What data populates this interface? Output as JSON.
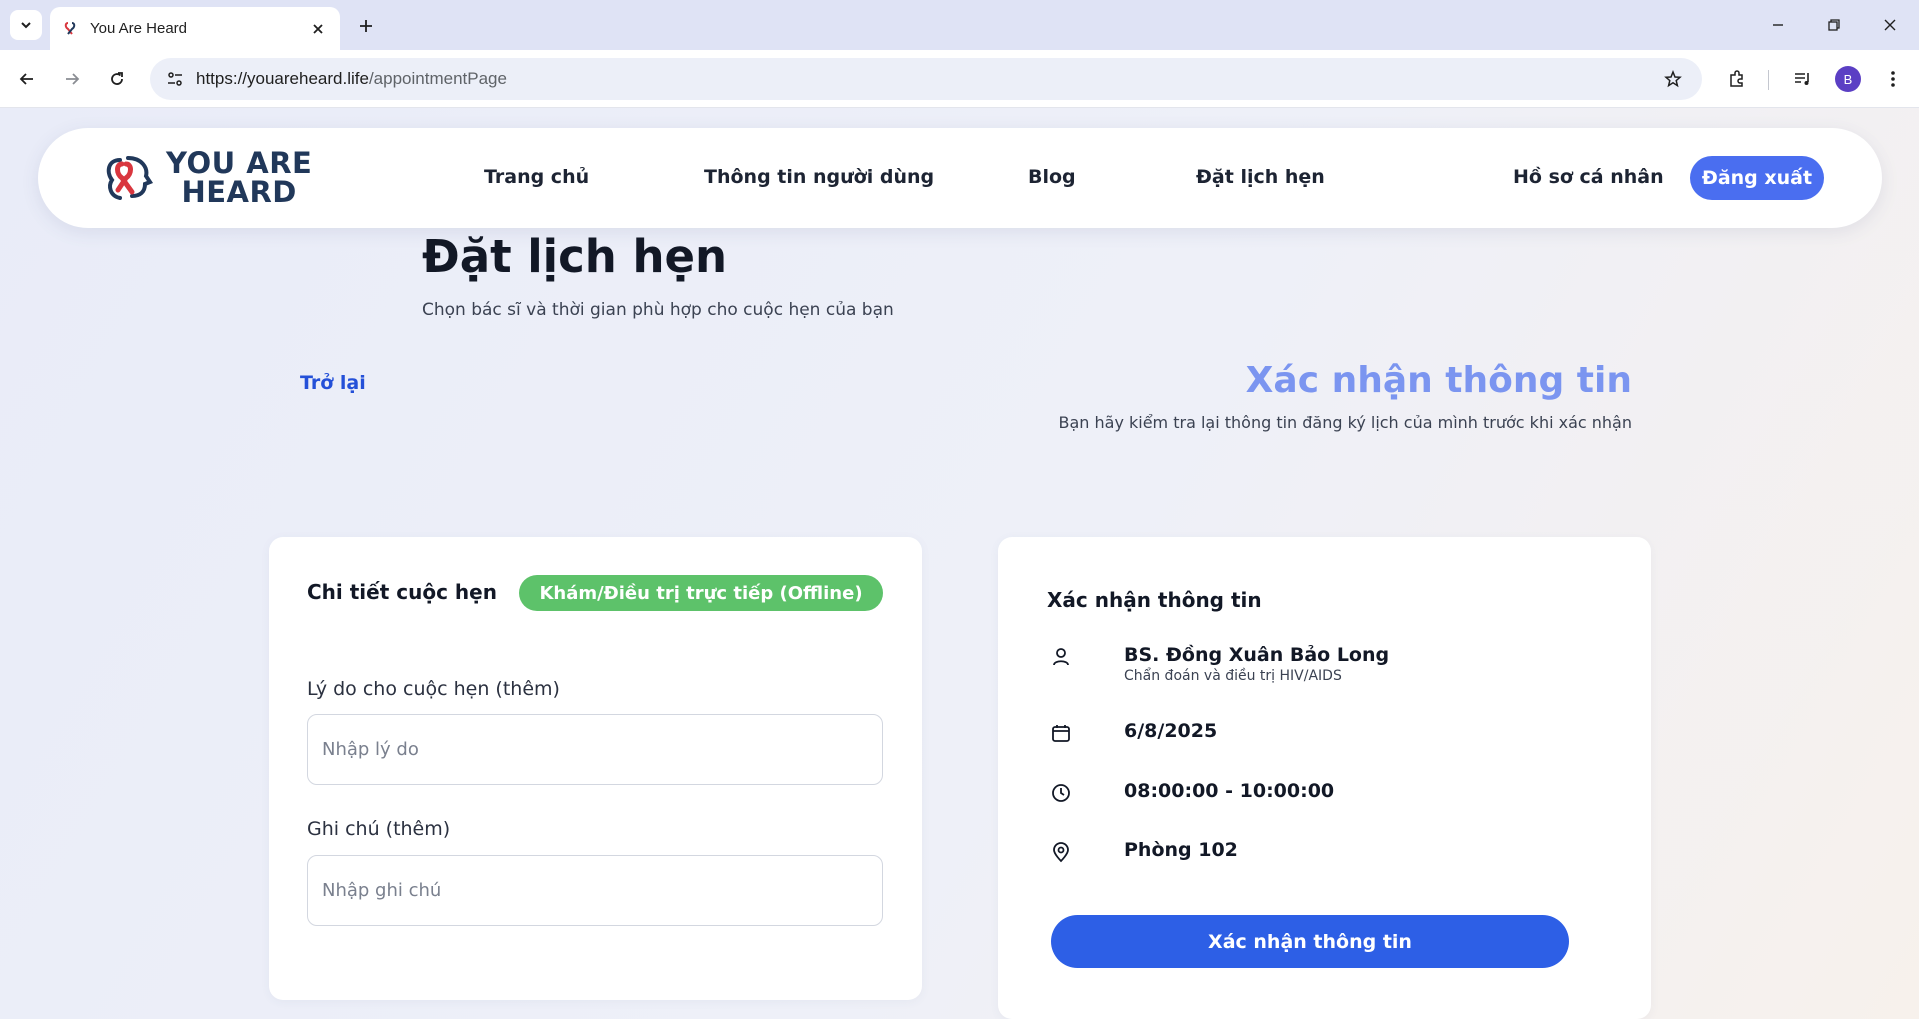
{
  "browser": {
    "tab_title": "You Are Heard",
    "url_host": "https://youareheard.life",
    "url_path": "/appointmentPage",
    "profile_initial": "B"
  },
  "header": {
    "logo_line1": "YOU ARE",
    "logo_line2": "HEARD",
    "nav": {
      "home": "Trang chủ",
      "user_info": "Thông tin người dùng",
      "blog": "Blog",
      "booking": "Đặt lịch hẹn"
    },
    "profile": "Hồ sơ cá nhân",
    "logout": "Đăng xuất"
  },
  "page": {
    "title": "Đặt lịch hẹn",
    "subtitle": "Chọn bác sĩ và thời gian phù hợp cho cuộc hẹn của bạn",
    "back": "Trở lại",
    "confirm_heading": "Xác nhận thông tin",
    "confirm_desc": "Bạn hãy kiểm tra lại thông tin đăng ký lịch của mình trước khi xác nhận"
  },
  "details": {
    "title": "Chi tiết cuộc hẹn",
    "badge": "Khám/Điều trị trực tiếp (Offline)",
    "reason_label": "Lý do cho cuộc hẹn (thêm)",
    "reason_placeholder": "Nhập lý do",
    "note_label": "Ghi chú (thêm)",
    "note_placeholder": "Nhập ghi chú"
  },
  "confirm": {
    "title": "Xác nhận thông tin",
    "doctor_name": "BS. Đồng Xuân Bảo Long",
    "doctor_specialty": "Chẩn đoán và điều trị HIV/AIDS",
    "date": "6/8/2025",
    "time": "08:00:00 - 10:00:00",
    "room": "Phòng 102",
    "button": "Xác nhận thông tin"
  },
  "colors": {
    "primary": "#2d5fe6",
    "logout": "#4a6ef0",
    "badge_green": "#5dc26a",
    "heading_light_blue": "#7b95f0",
    "logo_navy": "#21385a",
    "logo_red": "#d9363e"
  }
}
